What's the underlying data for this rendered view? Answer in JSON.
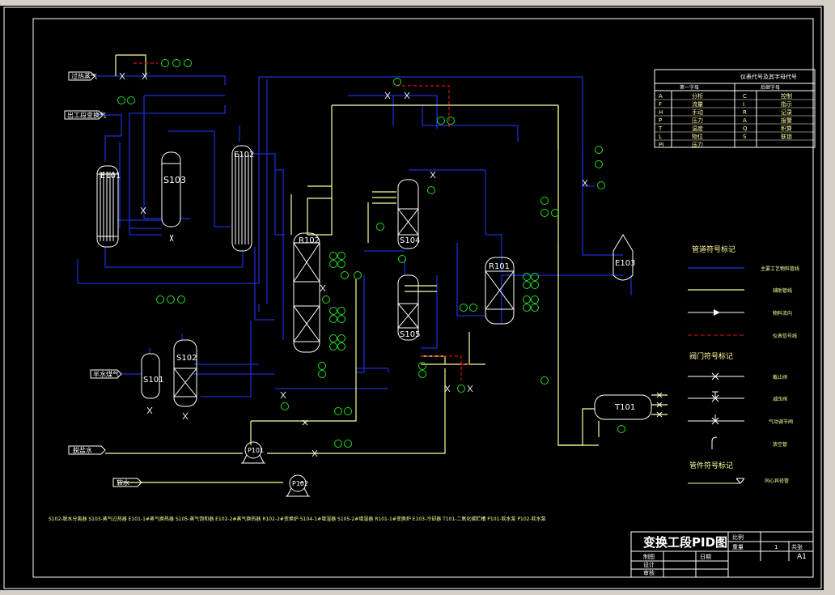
{
  "drawing": {
    "title": "变换工段PID图",
    "sheet_size": "A1",
    "sheet_count": "1",
    "title_block": {
      "scale_label": "比例",
      "weight_label": "重量",
      "count_label": "共张",
      "drawn_label": "制图",
      "design_label": "设计",
      "review_label": "审核",
      "date_label": "日期"
    }
  },
  "streams": {
    "process_gas": "过热蒸气",
    "out_gas": "出工段变换气",
    "in_gas": "半水煤气",
    "water1": "脱盐水",
    "water2": "软水"
  },
  "equipment": [
    "E101",
    "S103",
    "E102",
    "R102",
    "S104",
    "R101",
    "E103",
    "S101",
    "S102",
    "S105",
    "T101",
    "P101",
    "P102"
  ],
  "instrument_legend": {
    "title": "仪表代号及其字母代号",
    "col1_header": "第一字母",
    "col2_header": "后继字母",
    "rows": [
      {
        "a": "A",
        "b": "分析",
        "c": "C",
        "d": "控制"
      },
      {
        "a": "F",
        "b": "流量",
        "c": "I",
        "d": "指示"
      },
      {
        "a": "H",
        "b": "手动",
        "c": "R",
        "d": "记录"
      },
      {
        "a": "P",
        "b": "压力",
        "c": "A",
        "d": "报警"
      },
      {
        "a": "T",
        "b": "温度",
        "c": "Q",
        "d": "积算"
      },
      {
        "a": "L",
        "b": "物位",
        "c": "S",
        "d": "联锁"
      },
      {
        "a": "PI",
        "b": "压力",
        "c": "",
        "d": ""
      }
    ]
  },
  "line_legend": {
    "title": "管道符号标记",
    "items": [
      "主要工艺物料管线",
      "辅助管线",
      "物料流向",
      "仪表信号线"
    ]
  },
  "valve_legend": {
    "title": "阀门符号标记",
    "items": [
      "截止阀",
      "减压阀",
      "气动调节阀",
      "放空管"
    ]
  },
  "fitting_legend": {
    "title": "管件符号标记",
    "items": [
      "同心异径管"
    ]
  },
  "equipment_note": "S102-脱水分离器  S103-蒸气过热器  E101-1#蒸气换热器  S105-蒸气饱和器  E102-2#蒸气换热器  R102-2#变换炉  S104-1#增湿器  S105-2#增湿器  R101-1#变换炉  E103-冷却器  T101-二氧化碳贮槽  P101-软水泵  P102-软水泵",
  "colors": {
    "main": "#1a2fd0",
    "aux": "#ffff9a",
    "signal": "#e01010",
    "instrument": "#22dd22",
    "white": "#ffffff",
    "frame": "#ffffff"
  }
}
